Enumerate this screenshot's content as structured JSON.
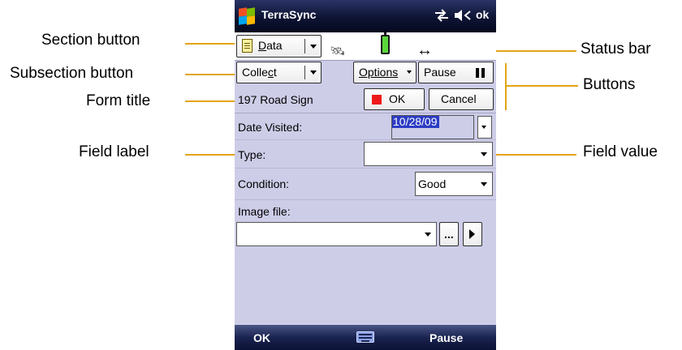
{
  "callouts": {
    "section_button": "Section button",
    "subsection_button": "Subsection button",
    "form_title": "Form title",
    "field_label": "Field label",
    "status_bar": "Status bar",
    "buttons": "Buttons",
    "field_value": "Field value"
  },
  "title_bar": {
    "app_name": "TerraSync",
    "ok": "ok",
    "icons": [
      "windows-start-icon",
      "connectivity-icon",
      "volume-icon"
    ]
  },
  "status_row": {
    "section": {
      "label": "Data",
      "underline": "D",
      "rest": "ata"
    },
    "icons": [
      "satellite-icon",
      "battery-icon",
      "offset-arrows-icon"
    ]
  },
  "subsection_row": {
    "subsection": {
      "label": "Collect",
      "pre": "Colle",
      "underline": "c",
      "post": "t"
    },
    "options": "Options",
    "pause": "Pause"
  },
  "form_row": {
    "title": "197 Road Sign",
    "ok": "OK",
    "cancel": "Cancel"
  },
  "fields": {
    "date_visited": {
      "label": "Date Visited:",
      "value": "10/28/09"
    },
    "type": {
      "label": "Type:",
      "value": ""
    },
    "condition": {
      "label": "Condition:",
      "value": "Good"
    },
    "image_file": {
      "label": "Image file:",
      "value": "",
      "browse": "..."
    }
  },
  "softkeys": {
    "left": "OK",
    "right": "Pause"
  },
  "colors": {
    "callout_line": "#e3a416",
    "form_bg": "#cdcde8",
    "title_bar": "#0d1433",
    "selection": "#2c3cc4",
    "ok_square": "#ee1a1a"
  }
}
